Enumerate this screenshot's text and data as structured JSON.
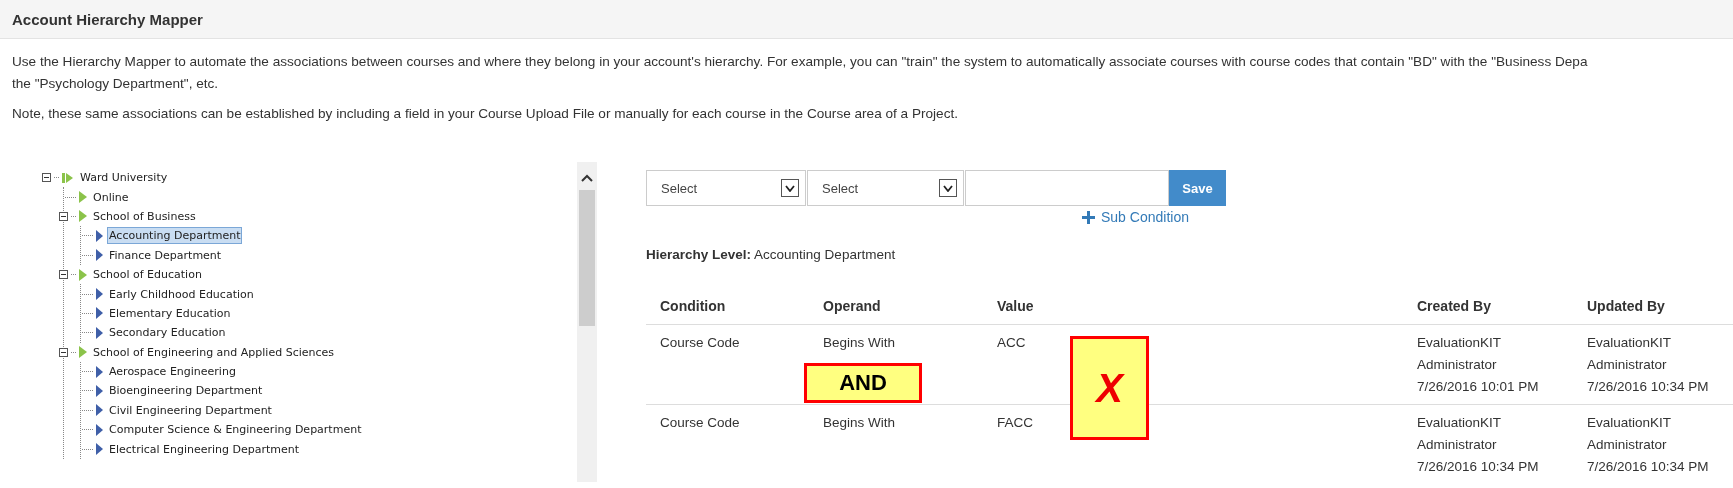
{
  "header": {
    "title": "Account Hierarchy Mapper"
  },
  "description": [
    "Use the Hierarchy Mapper to automate the associations between courses and where they belong in your account's hierarchy. For example, you can \"train\" the system to automatically associate courses with course codes that contain \"BD\" with the \"Business Depa",
    "the \"Psychology Department\", etc."
  ],
  "note": "Note, these same associations can be established by including a field in your Course Upload File or manually for each course in the Course area of a Project.",
  "tree": [
    {
      "label": "Ward University",
      "kind": "root",
      "selected": false,
      "expanded": true,
      "children": [
        {
          "label": "Online",
          "kind": "branch",
          "selected": false
        },
        {
          "label": "School of Business",
          "kind": "branch",
          "selected": false,
          "expanded": true,
          "children": [
            {
              "label": "Accounting Department",
              "kind": "leaf",
              "selected": true
            },
            {
              "label": "Finance Department",
              "kind": "leaf",
              "selected": false
            }
          ]
        },
        {
          "label": "School of Education",
          "kind": "branch",
          "selected": false,
          "expanded": true,
          "children": [
            {
              "label": "Early Childhood Education",
              "kind": "leaf",
              "selected": false
            },
            {
              "label": "Elementary Education",
              "kind": "leaf",
              "selected": false
            },
            {
              "label": "Secondary Education",
              "kind": "leaf",
              "selected": false
            }
          ]
        },
        {
          "label": "School of Engineering and Applied Sciences",
          "kind": "branch",
          "selected": false,
          "expanded": true,
          "children": [
            {
              "label": "Aerospace Engineering",
              "kind": "leaf",
              "selected": false
            },
            {
              "label": "Bioengineering Department",
              "kind": "leaf",
              "selected": false
            },
            {
              "label": "Civil Engineering Department",
              "kind": "leaf",
              "selected": false
            },
            {
              "label": "Computer Science & Engineering Department",
              "kind": "leaf",
              "selected": false
            },
            {
              "label": "Electrical Engineering Department",
              "kind": "leaf",
              "selected": false
            }
          ]
        }
      ]
    }
  ],
  "condition_form": {
    "selects": [
      "Select",
      "Select"
    ],
    "save_button": "Save",
    "sub_condition_link": "Sub Condition"
  },
  "hierarchy_level": {
    "label": "Hierarchy Level:",
    "value": "Accounting Department"
  },
  "table": {
    "columns": [
      "Condition",
      "Operand",
      "Value",
      "Created By",
      "Updated By"
    ],
    "rows": [
      {
        "cells": [
          "Course Code",
          "Begins With",
          "ACC",
          [
            "EvaluationKIT",
            "Administrator",
            "7/26/2016 10:01 PM"
          ],
          [
            "EvaluationKIT",
            "Administrator",
            "7/26/2016 10:34 PM"
          ]
        ]
      },
      {
        "cells": [
          "Course Code",
          "Begins With",
          "FACC",
          [
            "EvaluationKIT",
            "Administrator",
            "7/26/2016 10:34 PM"
          ],
          [
            "EvaluationKIT",
            "Administrator",
            "7/26/2016 10:34 PM"
          ]
        ]
      }
    ]
  },
  "annotations": [
    {
      "kind": "label",
      "text": "AND"
    },
    {
      "kind": "mark",
      "text": "X"
    }
  ]
}
